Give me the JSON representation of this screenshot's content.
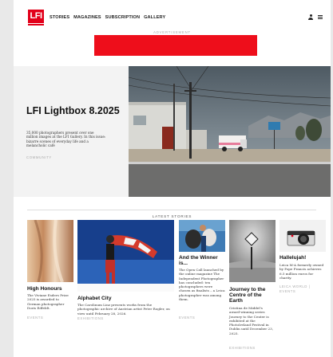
{
  "header": {
    "logo": "LFI",
    "nav": [
      "STORIES",
      "MAGAZINES",
      "SUBSCRIPTION",
      "GALLERY"
    ]
  },
  "ad": {
    "label": "ADVERTISEMENT"
  },
  "hero": {
    "title": "LFI Lightbox 8.2025",
    "description": "35,000 photographers present over one million images at the LFI Gallery. In this issue: bizarre scenes of everyday life and a melancholic café",
    "category": "COMMUNITY"
  },
  "latest": {
    "label": "LATEST STORIES"
  },
  "stories": [
    {
      "title": "High Honours",
      "description": "The Viviane Esders Prize 2025 is awarded to German photographer Doris Edfeldt.",
      "category": "EVENTS"
    },
    {
      "title": "Alphabet City",
      "description": "The Carolinum Linz presents works from the photographic archive of Austrian artist Peter Rogler, on view until February 28, 2026.",
      "category": "EXHIBITIONS"
    },
    {
      "title": "And the Winner is...",
      "description": "The Open Call launched by the online magazine The Independent Photographer has concluded: ten photographers were chosen as finalists – a Leica photographer was among them.",
      "category": "EVENTS"
    },
    {
      "title": "Journey to the Centre of the Earth",
      "description": "Cristina de Middel's award-winning series Journey to the Center is exhibited at the PhotoIreland Festival in Dublin until December 23, 2025.",
      "category": "EXHIBITIONS"
    },
    {
      "title": "Hallelujah!",
      "description": "Leica M-A formerly owned by Pope Francis achieves 6.5 million euros for charity.",
      "category": "LEICA WORLD | EVENTS"
    }
  ],
  "colors": {
    "accent": "#e2001a",
    "ad_banner": "#ee0e1b"
  }
}
